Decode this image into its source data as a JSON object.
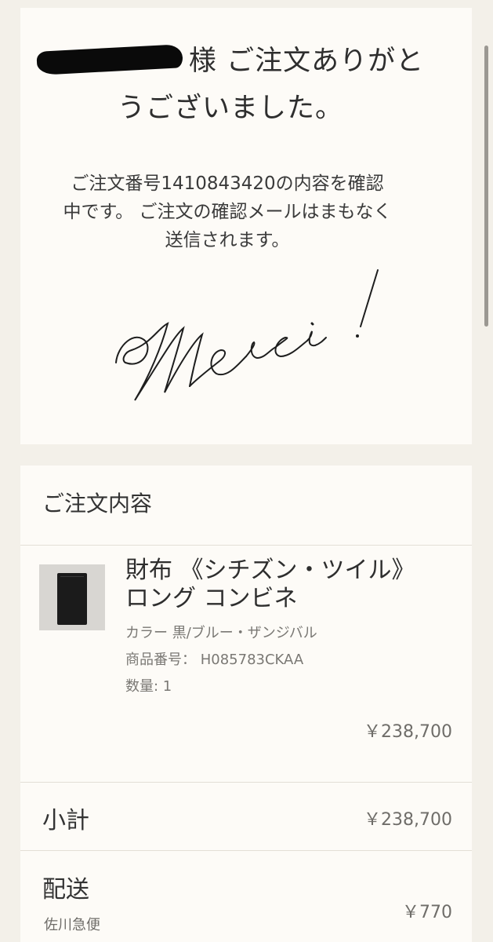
{
  "confirmation": {
    "customer_name_suffix": "様",
    "headline_rest": "ご注文ありがとうございました。",
    "notice_line1": "ご注文番号1410843420の内容を確認",
    "notice_line2": "中です。 ご注文の確認メールはまもなく",
    "notice_line3": "送信されます。",
    "signature_text": "Merci !"
  },
  "order": {
    "section_title": "ご注文内容",
    "item": {
      "name_line1": "財布 《シチズン・ツイル》",
      "name_line2": "ロング コンビネ",
      "color": "カラー 黒/ブルー・ザンジバル",
      "sku": "商品番号： H085783CKAA",
      "quantity": "数量: 1",
      "price": "￥238,700"
    },
    "subtotal_label": "小計",
    "subtotal_value": "￥238,700",
    "shipping_label": "配送",
    "shipping_carrier": "佐川急便",
    "shipping_value": "￥770"
  }
}
